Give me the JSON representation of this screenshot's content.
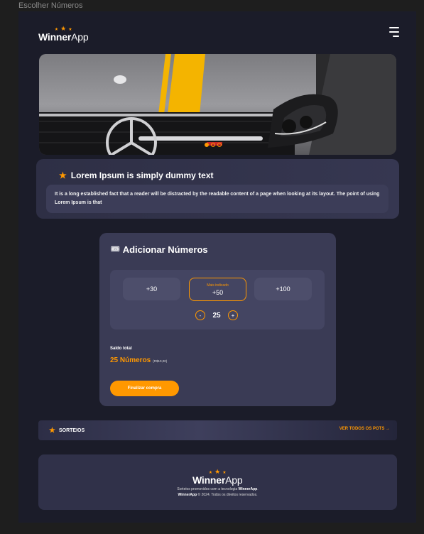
{
  "frame": {
    "label": "Escolher Números"
  },
  "header": {
    "logo": {
      "part1": "Winner",
      "part2": "App"
    }
  },
  "info": {
    "title": "Lorem Ipsum is simply dummy text",
    "text": "It is a long established fact that a reader will be distracted by the readable content of a page when looking at its layout. The point of using Lorem Ipsum is that"
  },
  "add_numbers": {
    "heading": "Adicionar Números",
    "options": [
      {
        "label": "+30"
      },
      {
        "label": "+50",
        "recommended": "Mais indicado"
      },
      {
        "label": "+100"
      }
    ],
    "stepper": {
      "minus": "-",
      "value": "25",
      "plus": "+"
    },
    "balance_label": "Saldo total",
    "balance_value": "25 Números",
    "balance_price": "(R$10,00)",
    "finish_button": "Finalizar compra"
  },
  "raffles": {
    "label": "SORTEIOS",
    "see_all": "VER TODOS OS POTS  →"
  },
  "footer": {
    "logo": {
      "part1": "Winner",
      "part2": "App"
    },
    "line1_prefix": "Sorteios promovidos com a tecnologia ",
    "line1_brand": "WinnerApp",
    "line1_suffix": ".",
    "line2_brand": "WinnerApp",
    "line2_rest": " © 2024. Todos os direitos reservados."
  },
  "colors": {
    "accent": "#ff9800",
    "background": "#1b1c29",
    "card": "#3a3b55"
  },
  "icons": {
    "menu": "hamburger-icon",
    "star": "star-icon",
    "ticket": "ticket-icon",
    "arrow": "arrow-right-icon"
  }
}
